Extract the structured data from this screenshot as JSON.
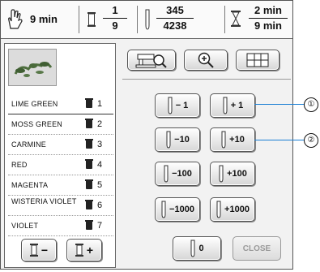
{
  "statusbar": {
    "time": "9 min",
    "color_current": "1",
    "color_total": "9",
    "stitch_current": "345",
    "stitch_total": "4238",
    "time_elapsed": "2 min",
    "time_total": "9 min"
  },
  "thread_list": [
    {
      "name": "LIME GREEN",
      "number": "1",
      "selected": true
    },
    {
      "name": "MOSS GREEN",
      "number": "2"
    },
    {
      "name": "CARMINE",
      "number": "3"
    },
    {
      "name": "RED",
      "number": "4"
    },
    {
      "name": "MAGENTA",
      "number": "5"
    },
    {
      "name": "WISTERIA VIOLET",
      "number": "6"
    },
    {
      "name": "VIOLET",
      "number": "7"
    }
  ],
  "color_nav": {
    "prev_label": "−",
    "next_label": "+"
  },
  "tools": {
    "embroider_icon": "sewing-machine-magnifier-icon",
    "zoom_icon": "zoom-in-icon",
    "grid_icon": "grid-icon"
  },
  "stitch_buttons": {
    "minus1": "− 1",
    "plus1": "+ 1",
    "minus10": "−10",
    "plus10": "+10",
    "minus100": "−100",
    "plus100": "+100",
    "minus1000": "−1000",
    "plus1000": "+1000"
  },
  "bottom": {
    "zero_label": "0",
    "close_label": "CLOSE"
  },
  "callouts": {
    "one": "①",
    "two": "②"
  }
}
